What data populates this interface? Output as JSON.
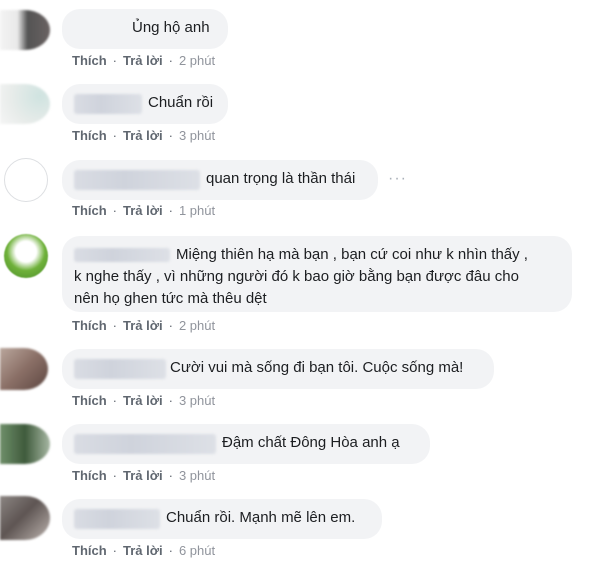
{
  "comments": [
    {
      "text": "Ủng hộ anh",
      "like": "Thích",
      "reply": "Trả lời",
      "time": "2 phút"
    },
    {
      "text": "Chuẩn rồi",
      "like": "Thích",
      "reply": "Trả lời",
      "time": "3 phút"
    },
    {
      "text": "quan trọng là thần thái",
      "like": "Thích",
      "reply": "Trả lời",
      "time": "1 phút",
      "more": "···"
    },
    {
      "line1": "Miệng thiên hạ mà bạn , bạn cứ coi như k nhìn thấy ,",
      "line2": "k nghe thấy , vì những người đó k bao giờ bằng bạn được đâu cho",
      "line3": "nên họ ghen tức mà thêu dệt",
      "like": "Thích",
      "reply": "Trả lời",
      "time": "2 phút"
    },
    {
      "text": "Cười vui mà sống đi bạn tôi. Cuộc sống mà!",
      "like": "Thích",
      "reply": "Trả lời",
      "time": "3 phút"
    },
    {
      "text": "Đậm chất Đông Hòa anh ạ",
      "like": "Thích",
      "reply": "Trả lời",
      "time": "3 phút"
    },
    {
      "text": "Chuẩn rồi. Mạnh mẽ lên em.",
      "like": "Thích",
      "reply": "Trả lời",
      "time": "6 phút"
    }
  ],
  "colors": {
    "bubble": "#f2f3f5",
    "action": "#606770",
    "time": "#90949c"
  }
}
